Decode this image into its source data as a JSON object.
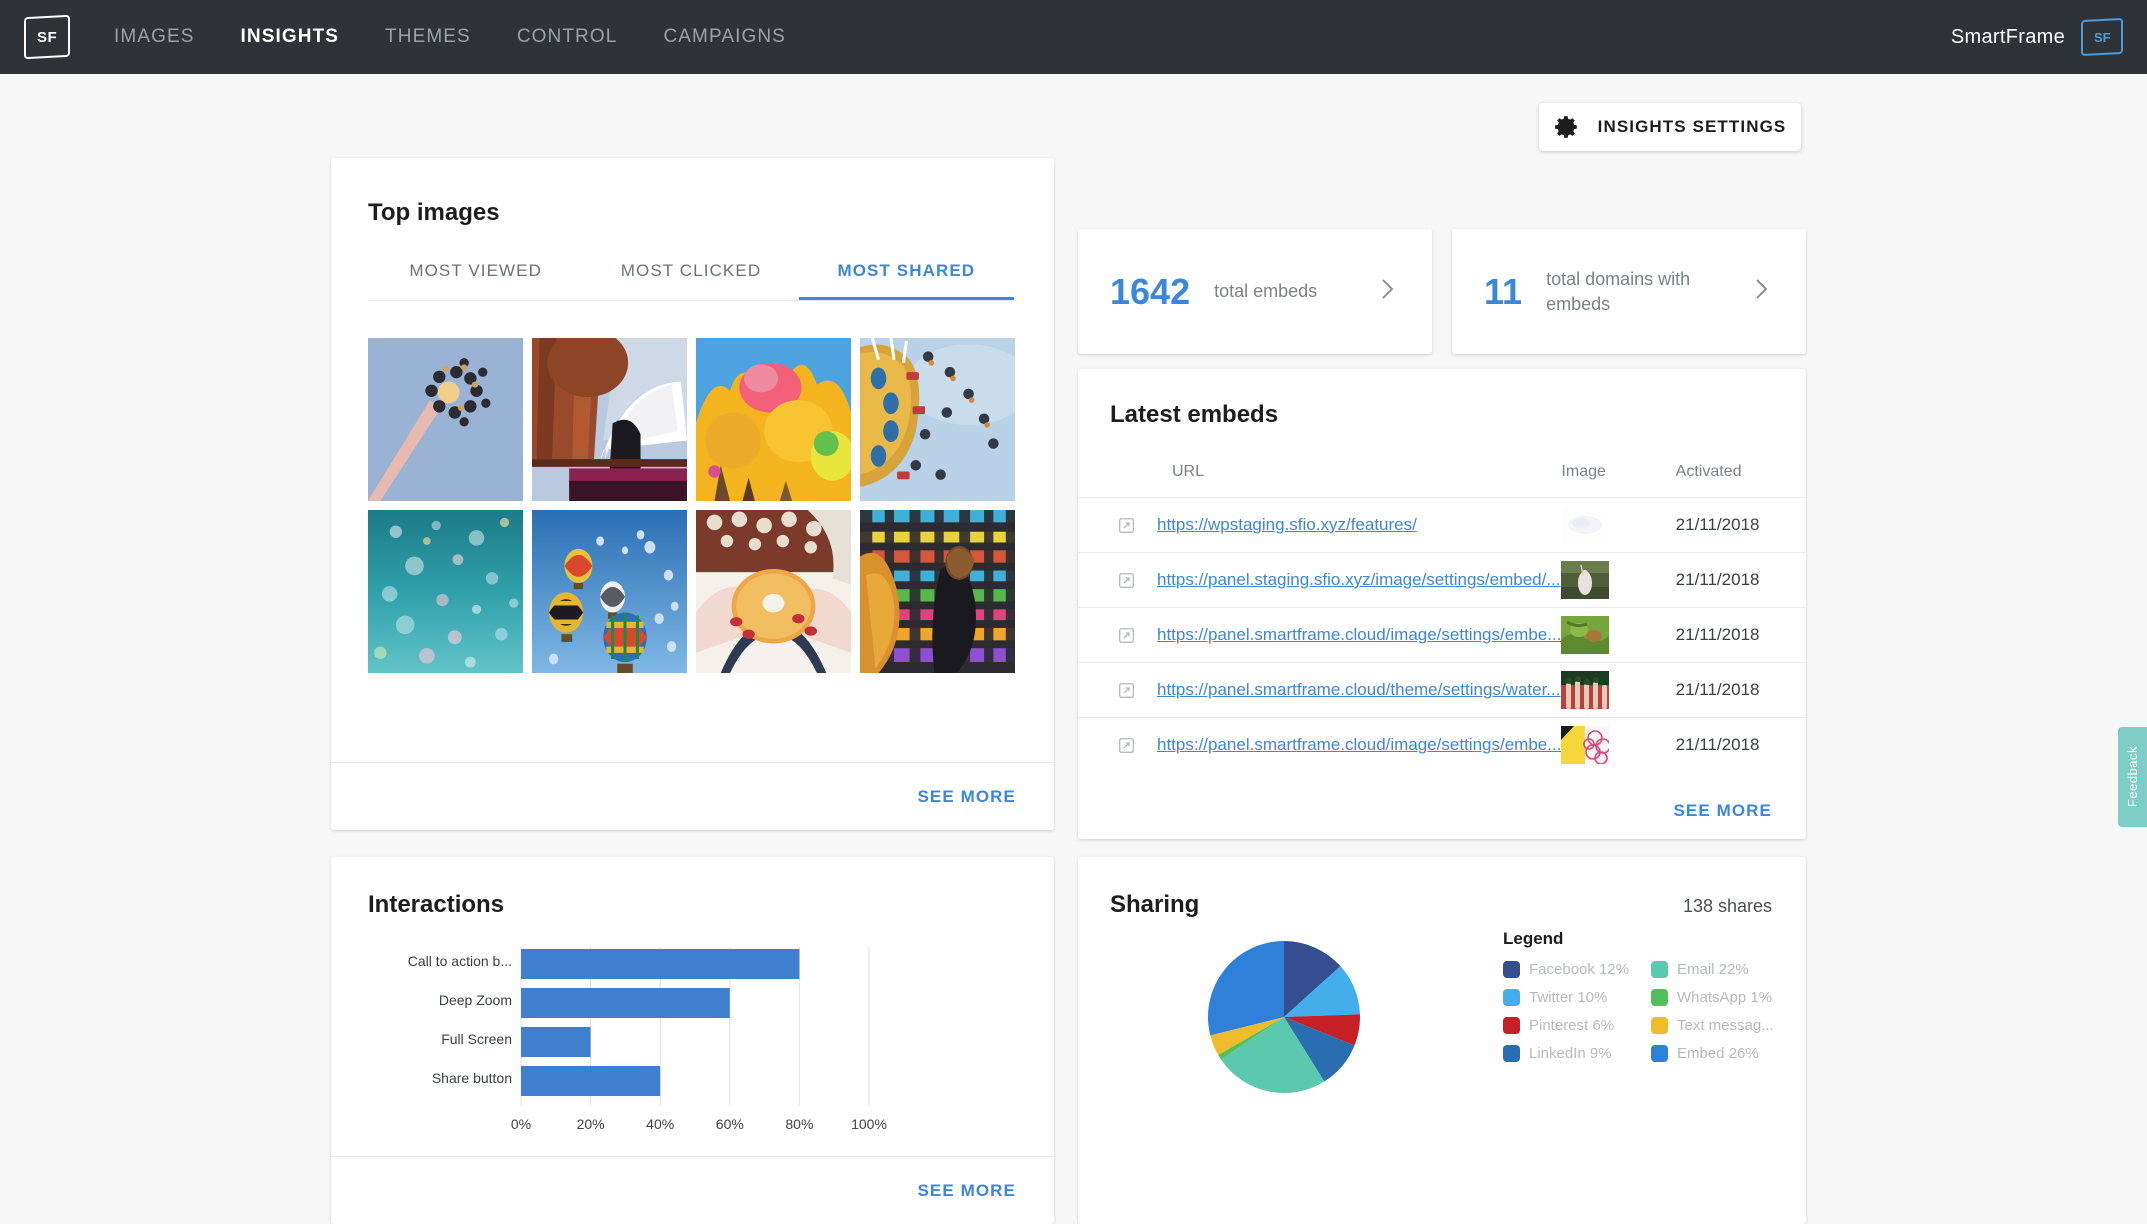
{
  "nav": {
    "logo_text": "SF",
    "items": [
      {
        "label": "IMAGES",
        "active": false
      },
      {
        "label": "INSIGHTS",
        "active": true
      },
      {
        "label": "THEMES",
        "active": false
      },
      {
        "label": "CONTROL",
        "active": false
      },
      {
        "label": "CAMPAIGNS",
        "active": false
      }
    ],
    "brand_name": "SmartFrame",
    "brand_logo_text": "SF"
  },
  "toolbar": {
    "settings_label": "INSIGHTS SETTINGS",
    "settings_icon": "gear-icon"
  },
  "top_images": {
    "title": "Top images",
    "tabs": [
      {
        "label": "MOST VIEWED",
        "active": false
      },
      {
        "label": "MOST CLICKED",
        "active": false
      },
      {
        "label": "MOST SHARED",
        "active": true
      }
    ],
    "thumbnails": [
      {
        "id": "thumb-1",
        "alt": "amusement park swing ride against blue sky"
      },
      {
        "id": "thumb-2",
        "alt": "hot air balloon envelope by modern building"
      },
      {
        "id": "thumb-3",
        "alt": "colour powder festival explosion"
      },
      {
        "id": "thumb-4",
        "alt": "fairground chair swing ride in sky"
      },
      {
        "id": "thumb-5",
        "alt": "teal water with bokeh confetti"
      },
      {
        "id": "thumb-6",
        "alt": "hot air balloons rising in blue sky"
      },
      {
        "id": "thumb-7",
        "alt": "hands holding a doughnut"
      },
      {
        "id": "thumb-8",
        "alt": "colourful striped market stall"
      }
    ],
    "see_more_label": "SEE MORE"
  },
  "stats": [
    {
      "id": "total-embeds",
      "value": "1642",
      "label": "total embeds",
      "chevron": "chevron-right-icon"
    },
    {
      "id": "total-domains",
      "value": "11",
      "label": "total domains with embeds",
      "chevron": "chevron-right-icon"
    }
  ],
  "latest_embeds": {
    "title": "Latest embeds",
    "columns": [
      "URL",
      "Image",
      "Activated"
    ],
    "rows": [
      {
        "url": "https://wpstaging.sfio.xyz/features/",
        "activated": "21/11/2018",
        "thumb": "thumb-e1"
      },
      {
        "url": "https://panel.staging.sfio.xyz/image/settings/embed/...",
        "activated": "21/11/2018",
        "thumb": "thumb-e2"
      },
      {
        "url": "https://panel.smartframe.cloud/image/settings/embe...",
        "activated": "21/11/2018",
        "thumb": "thumb-e3"
      },
      {
        "url": "https://panel.smartframe.cloud/theme/settings/water...",
        "activated": "21/11/2018",
        "thumb": "thumb-e4"
      },
      {
        "url": "https://panel.smartframe.cloud/image/settings/embe...",
        "activated": "21/11/2018",
        "thumb": "thumb-e5"
      }
    ],
    "see_more_label": "SEE MORE"
  },
  "interactions": {
    "title": "Interactions",
    "see_more_label": "SEE MORE"
  },
  "sharing": {
    "title": "Sharing",
    "shares_text": "138 shares",
    "legend_title": "Legend"
  },
  "feedback": {
    "label": "Feedback"
  },
  "colors": {
    "accent_blue": "#3d87d8",
    "bar_blue": "#3f7fcf",
    "nav_dark": "#2e3338",
    "feedback_teal": "#7fcdc7"
  },
  "chart_data": [
    {
      "type": "bar",
      "orientation": "horizontal",
      "title": "Interactions",
      "categories": [
        "Call to action b...",
        "Deep Zoom",
        "Full Screen",
        "Share button"
      ],
      "values": [
        80,
        60,
        20,
        40
      ],
      "xlabel": "",
      "ylabel": "",
      "xlim": [
        0,
        100
      ],
      "xticks": [
        "0%",
        "20%",
        "40%",
        "60%",
        "80%",
        "100%"
      ],
      "grid": true,
      "series_color": "#3f7fcf"
    },
    {
      "type": "pie",
      "title": "Sharing",
      "total_label": "138 shares",
      "legend_position": "right",
      "labels": [
        "Facebook",
        "Twitter",
        "Pinterest",
        "LinkedIn",
        "Email",
        "WhatsApp",
        "Text messag...",
        "Embed"
      ],
      "values": [
        12,
        10,
        6,
        9,
        22,
        1,
        4,
        26
      ],
      "legend_entries": [
        {
          "label": "Facebook 12%",
          "color": "#344e8f",
          "column": "left"
        },
        {
          "label": "Twitter 10%",
          "color": "#44aeea",
          "column": "left"
        },
        {
          "label": "Pinterest 6%",
          "color": "#c42026",
          "column": "left"
        },
        {
          "label": "LinkedIn 9%",
          "color": "#2a6eb2",
          "column": "left"
        },
        {
          "label": "Email 22%",
          "color": "#5bc9ae",
          "column": "right"
        },
        {
          "label": "WhatsApp 1%",
          "color": "#52bf5b",
          "column": "right"
        },
        {
          "label": "Text messag...",
          "color": "#efbb2c",
          "column": "right"
        },
        {
          "label": "Embed 26%",
          "color": "#2f80d8",
          "column": "right"
        }
      ]
    }
  ]
}
